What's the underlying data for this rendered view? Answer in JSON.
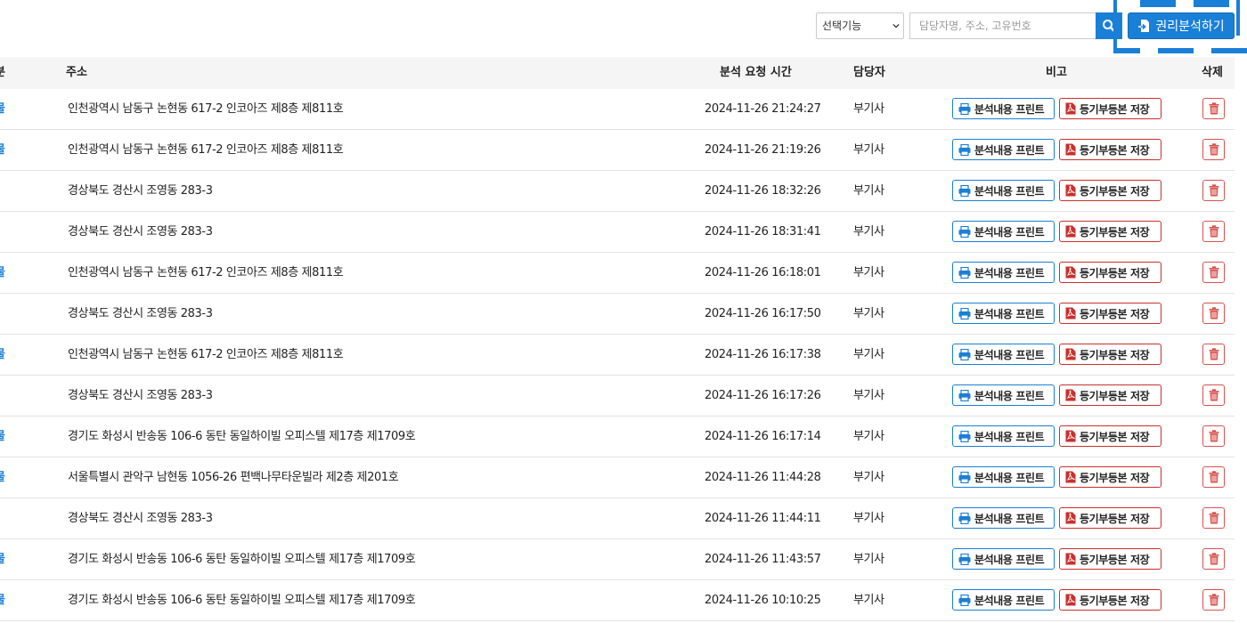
{
  "toolbar": {
    "select_value": "선택기능",
    "search_placeholder": "담당자명, 주소, 고유번호",
    "analyze_label": "권리분석하기"
  },
  "table": {
    "headers": {
      "type": "분",
      "address": "주소",
      "time": "분석 요청 시간",
      "manager": "담당자",
      "note": "비고",
      "delete": "삭제"
    },
    "print_label": "분석내용 프린트",
    "save_label": "등기부등본 저장",
    "rows": [
      {
        "type": "물",
        "address": "인천광역시 남동구 논현동 617-2 인코아즈 제8층 제811호",
        "time": "2024-11-26 21:24:27",
        "manager": "부기사"
      },
      {
        "type": "물",
        "address": "인천광역시 남동구 논현동 617-2 인코아즈 제8층 제811호",
        "time": "2024-11-26 21:19:26",
        "manager": "부기사"
      },
      {
        "type": "",
        "address": "경상북도 경산시 조영동 283-3",
        "time": "2024-11-26 18:32:26",
        "manager": "부기사"
      },
      {
        "type": "",
        "address": "경상북도 경산시 조영동 283-3",
        "time": "2024-11-26 18:31:41",
        "manager": "부기사"
      },
      {
        "type": "물",
        "address": "인천광역시 남동구 논현동 617-2 인코아즈 제8층 제811호",
        "time": "2024-11-26 16:18:01",
        "manager": "부기사"
      },
      {
        "type": "",
        "address": "경상북도 경산시 조영동 283-3",
        "time": "2024-11-26 16:17:50",
        "manager": "부기사"
      },
      {
        "type": "물",
        "address": "인천광역시 남동구 논현동 617-2 인코아즈 제8층 제811호",
        "time": "2024-11-26 16:17:38",
        "manager": "부기사"
      },
      {
        "type": "",
        "address": "경상북도 경산시 조영동 283-3",
        "time": "2024-11-26 16:17:26",
        "manager": "부기사"
      },
      {
        "type": "물",
        "address": "경기도 화성시 반송동 106-6 동탄 동일하이빌 오피스텔 제17층 제1709호",
        "time": "2024-11-26 16:17:14",
        "manager": "부기사"
      },
      {
        "type": "물",
        "address": "서울특별시 관악구 남현동 1056-26 편백나무타운빌라 제2층 제201호",
        "time": "2024-11-26 11:44:28",
        "manager": "부기사"
      },
      {
        "type": "",
        "address": "경상북도 경산시 조영동 283-3",
        "time": "2024-11-26 11:44:11",
        "manager": "부기사"
      },
      {
        "type": "물",
        "address": "경기도 화성시 반송동 106-6 동탄 동일하이빌 오피스텔 제17층 제1709호",
        "time": "2024-11-26 11:43:57",
        "manager": "부기사"
      },
      {
        "type": "물",
        "address": "경기도 화성시 반송동 106-6 동탄 동일하이빌 오피스텔 제17층 제1709호",
        "time": "2024-11-26 10:10:25",
        "manager": "부기사"
      }
    ]
  },
  "colors": {
    "primary": "#1a7fd6",
    "danger": "#c9302c",
    "header_bg": "#f5f5f5"
  }
}
